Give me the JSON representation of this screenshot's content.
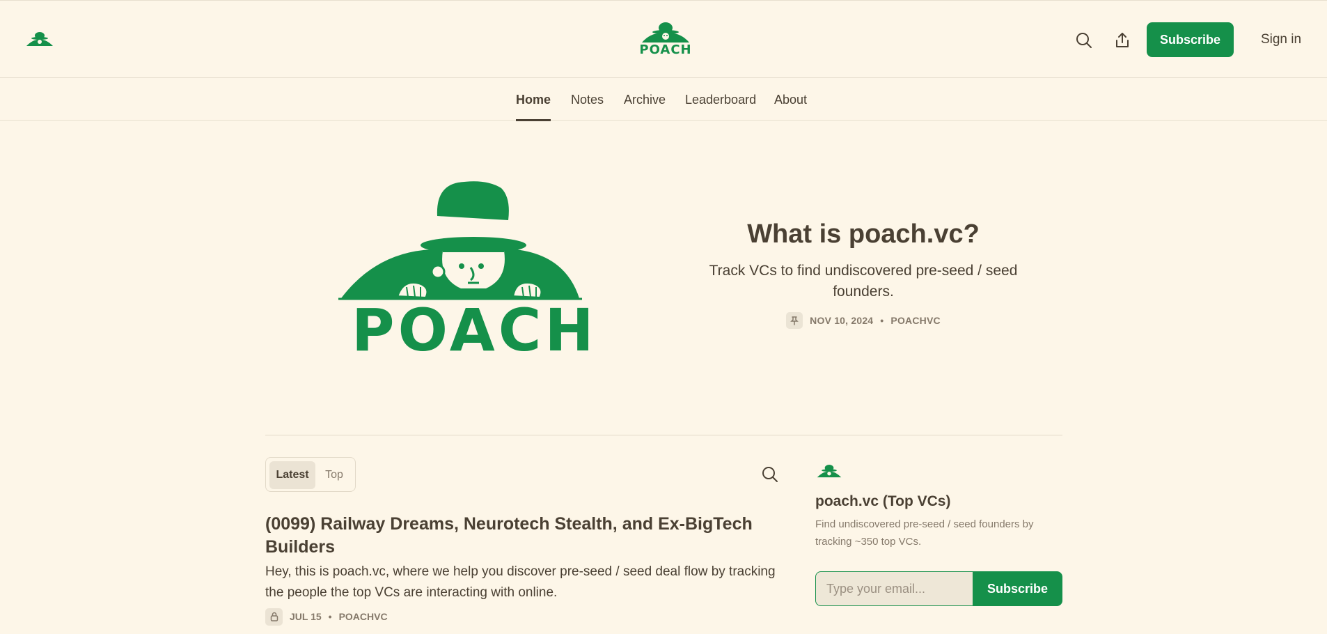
{
  "header": {
    "brand_word": "POACH",
    "subscribe_label": "Subscribe",
    "signin_label": "Sign in",
    "icons": [
      "search-icon",
      "share-icon"
    ]
  },
  "nav": {
    "items": [
      {
        "label": "Home",
        "active": true
      },
      {
        "label": "Notes"
      },
      {
        "label": "Archive"
      },
      {
        "label": "Leaderboard"
      },
      {
        "label": "About"
      }
    ]
  },
  "hero": {
    "logo_word": "POACH",
    "title": "What is poach.vc?",
    "subtitle": "Track VCs to find undiscovered pre-seed / seed founders.",
    "date": "NOV 10, 2024",
    "author": "POACHVC",
    "meta_sep": "•",
    "pin_icon": "pin-icon"
  },
  "feed": {
    "tabs": [
      "Latest",
      "Top"
    ],
    "selected_tab": "Latest",
    "posts": [
      {
        "title": "(0099) Railway Dreams, Neurotech Stealth, and Ex-BigTech Builders",
        "excerpt": "Hey, this is poach.vc, where we help you discover pre-seed / seed deal flow by tracking the people the top VCs are interacting with online.",
        "date": "JUL 15",
        "author": "POACHVC",
        "icon": "lock-icon"
      }
    ]
  },
  "sidebar": {
    "title": "poach.vc (Top VCs)",
    "description": "Find undiscovered pre-seed / seed founders by tracking ~350 top VCs.",
    "email_placeholder": "Type your email...",
    "subscribe_label": "Subscribe"
  },
  "colors": {
    "background": "#fdf6e8",
    "brand_green": "#15904a",
    "text": "#4a4033",
    "muted": "#85796a"
  }
}
